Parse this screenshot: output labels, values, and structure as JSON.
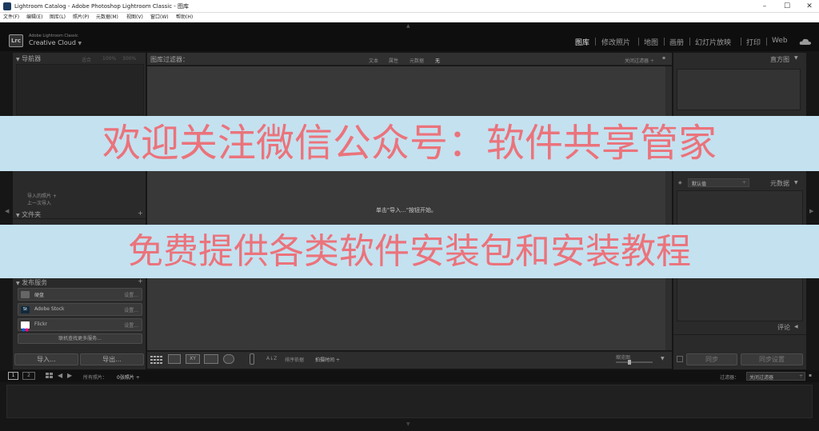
{
  "window": {
    "title": "Lightroom Catalog - Adobe Photoshop Lightroom Classic - 图库",
    "minimize": "–",
    "maximize": "☐",
    "close": "✕"
  },
  "menu": [
    "文件(F)",
    "编辑(E)",
    "图库(L)",
    "照片(P)",
    "元数据(M)",
    "视图(V)",
    "窗口(W)",
    "帮助(H)"
  ],
  "identity": {
    "badge": "Lrc",
    "line1": "Adobe Lightroom Classic",
    "line2": "Creative Cloud",
    "caret": "▼"
  },
  "modules": [
    "图库",
    "修改照片",
    "地图",
    "画册",
    "幻灯片放映",
    "打印",
    "Web"
  ],
  "left": {
    "navigator": {
      "title": "导航器",
      "opts": [
        "适合",
        "100%",
        "300%"
      ]
    },
    "catalog_items": [
      "导入的照片 +",
      "上一次导入"
    ],
    "folders": {
      "title": "文件夹",
      "plus": "+"
    },
    "publish": {
      "title": "发布服务",
      "plus": "+"
    },
    "services": [
      {
        "name": "硬盘",
        "state": "设置..."
      },
      {
        "name": "Adobe Stock",
        "state": "设置..."
      },
      {
        "name": "Flickr",
        "state": "设置..."
      }
    ],
    "find_more": "联机查找更多服务...",
    "import": "导入...",
    "export": "导出..."
  },
  "filter": {
    "title": "图库过滤器：",
    "tabs": [
      "文本",
      "属性",
      "元数据",
      "无"
    ],
    "preset": "关闭过滤器 ÷",
    "lock": "🔒"
  },
  "center_msg": "单击\"导入...\"按钮开始。",
  "toolbar": {
    "sort_label": "排序依据",
    "sort_value": "拍摄时间 ÷",
    "thumb_label": "缩览图"
  },
  "right": {
    "histogram": "直方图",
    "preset_value": "默认值",
    "metadata": "元数据",
    "comments": "评论",
    "sync": "同步",
    "sync_settings": "同步设置"
  },
  "filmstrip": {
    "page1": "1",
    "page2": "2",
    "source_prefix": "所有照片：",
    "source_count": "0张照片 ÷",
    "filter_label": "过滤器：",
    "filter_value": "关闭过滤器"
  },
  "watermark": {
    "line1": "欢迎关注微信公众号：软件共享管家",
    "line2": "免费提供各类软件安装包和安装教程"
  },
  "colors": {
    "watermark_text": "#eb737b",
    "watermark_bg": "#c4e1f0"
  }
}
